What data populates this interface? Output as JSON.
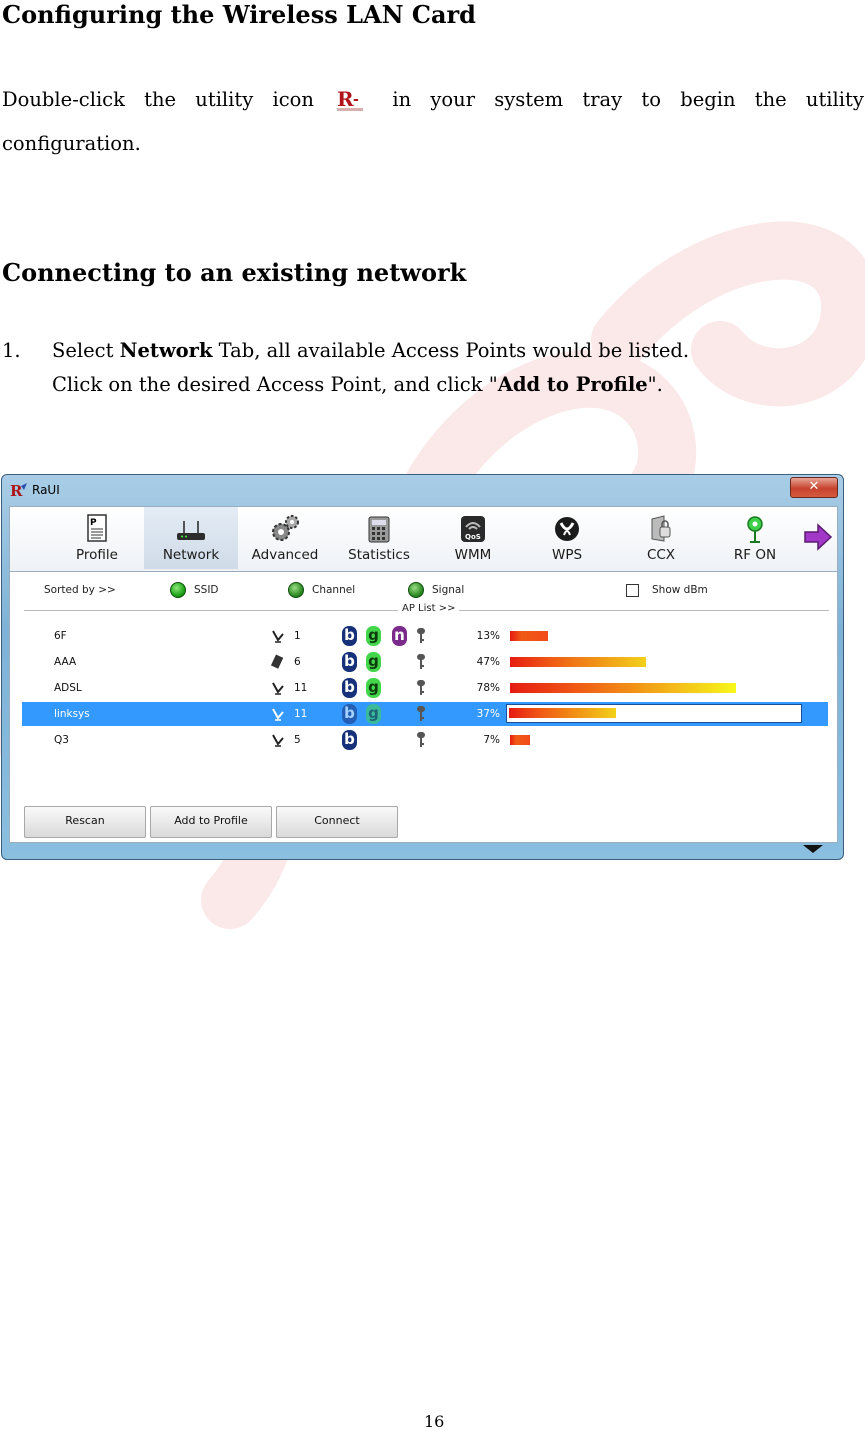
{
  "doc": {
    "heading1": "Configuring the Wireless LAN Card",
    "para_words": [
      "Double-click",
      "the",
      "utility",
      "icon",
      "",
      "in",
      "your",
      "system",
      "tray",
      "to",
      "begin",
      "the",
      "utility"
    ],
    "para_line2": "configuration.",
    "heading2": "Connecting to an existing network",
    "step_number": "1.",
    "step_pre": "Select ",
    "step_bold1": "Network",
    "step_mid": " Tab, all available Access Points would be listed.",
    "step_line2_pre": "Click on the desired Access Point, and click \"",
    "step_bold2": "Add to Profile",
    "step_line2_post": "\".",
    "page_number": "16"
  },
  "window": {
    "title": "RaUI",
    "close_label": "✕",
    "tabs": [
      {
        "label": "Profile",
        "icon": "profile-icon"
      },
      {
        "label": "Network",
        "icon": "router-icon",
        "active": true
      },
      {
        "label": "Advanced",
        "icon": "gears-icon"
      },
      {
        "label": "Statistics",
        "icon": "calculator-icon"
      },
      {
        "label": "WMM",
        "icon": "qos-icon"
      },
      {
        "label": "WPS",
        "icon": "wps-icon"
      },
      {
        "label": "CCX",
        "icon": "ccx-icon"
      },
      {
        "label": "RF ON",
        "icon": "rf-on-icon"
      }
    ],
    "sort": {
      "label": "Sorted by >>",
      "ssid": "SSID",
      "channel": "Channel",
      "signal": "Signal",
      "show_dbm": "Show dBm"
    },
    "ap_list_label": "AP List >>",
    "access_points": [
      {
        "ssid": "6F",
        "channel": "1",
        "modes": [
          "b",
          "g",
          "n"
        ],
        "signal": "13%",
        "signal_value": 13,
        "selected": false
      },
      {
        "ssid": "AAA",
        "channel": "6",
        "modes": [
          "b",
          "g"
        ],
        "signal": "47%",
        "signal_value": 47,
        "selected": false
      },
      {
        "ssid": "ADSL",
        "channel": "11",
        "modes": [
          "b",
          "g"
        ],
        "signal": "78%",
        "signal_value": 78,
        "selected": false
      },
      {
        "ssid": "linksys",
        "channel": "11",
        "modes": [
          "b",
          "g"
        ],
        "signal": "37%",
        "signal_value": 37,
        "selected": true
      },
      {
        "ssid": "Q3",
        "channel": "5",
        "modes": [
          "b"
        ],
        "signal": "7%",
        "signal_value": 7,
        "selected": false
      }
    ],
    "buttons": {
      "rescan": "Rescan",
      "add_to_profile": "Add to Profile",
      "connect": "Connect"
    }
  }
}
